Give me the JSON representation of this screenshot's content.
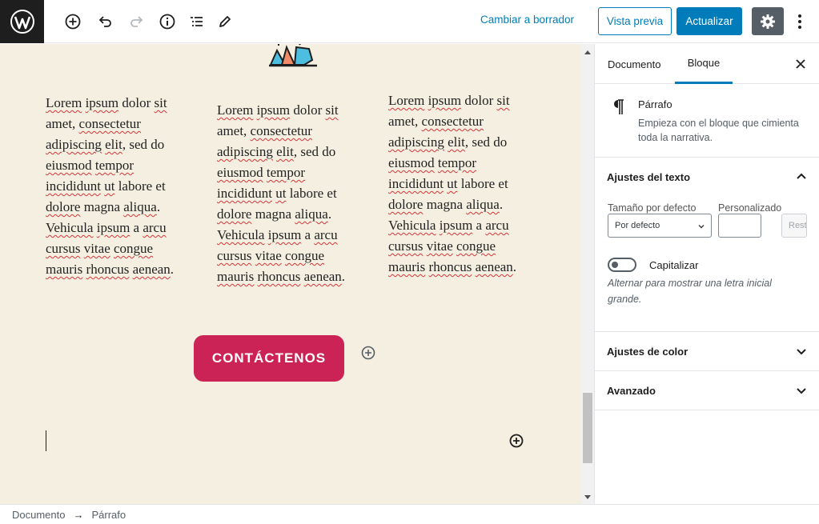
{
  "toolbar": {
    "switch_to_draft": "Cambiar a borrador",
    "preview": "Vista previa",
    "update": "Actualizar"
  },
  "content": {
    "columns": [
      [
        {
          "t": "Lorem",
          "s": true
        },
        {
          "t": " "
        },
        {
          "t": "ipsum",
          "s": true
        },
        {
          "t": " dolor "
        },
        {
          "t": "sit",
          "s": true
        },
        {
          "t": " amet, "
        },
        {
          "t": "consectetur",
          "s": true
        },
        {
          "t": " "
        },
        {
          "t": "adipiscing",
          "s": true
        },
        {
          "t": " "
        },
        {
          "t": "elit",
          "s": true
        },
        {
          "t": ", sed do "
        },
        {
          "t": "eiusmod",
          "s": true
        },
        {
          "t": " "
        },
        {
          "t": "tempor",
          "s": true
        },
        {
          "t": " "
        },
        {
          "t": "incididunt",
          "s": true
        },
        {
          "t": " "
        },
        {
          "t": "ut",
          "s": true
        },
        {
          "t": " labore et "
        },
        {
          "t": "dolore",
          "s": true
        },
        {
          "t": " magna "
        },
        {
          "t": "aliqua",
          "s": true
        },
        {
          "t": ". "
        },
        {
          "t": "Vehicula",
          "s": true
        },
        {
          "t": " "
        },
        {
          "t": "ipsum",
          "s": true
        },
        {
          "t": " a "
        },
        {
          "t": "arcu",
          "s": true
        },
        {
          "t": " "
        },
        {
          "t": "cursus",
          "s": true
        },
        {
          "t": " "
        },
        {
          "t": "vitae",
          "s": true
        },
        {
          "t": " "
        },
        {
          "t": "congue",
          "s": true
        },
        {
          "t": " "
        },
        {
          "t": "mauris",
          "s": true
        },
        {
          "t": " "
        },
        {
          "t": "rhoncus",
          "s": true
        },
        {
          "t": " "
        },
        {
          "t": "aenean",
          "s": true
        },
        {
          "t": "."
        }
      ],
      [
        {
          "t": "Lorem",
          "s": true
        },
        {
          "t": " "
        },
        {
          "t": "ipsum",
          "s": true
        },
        {
          "t": " dolor "
        },
        {
          "t": "sit",
          "s": true
        },
        {
          "t": " amet, "
        },
        {
          "t": "consectetur",
          "s": true
        },
        {
          "t": " "
        },
        {
          "t": "adipiscing",
          "s": true
        },
        {
          "t": " "
        },
        {
          "t": "elit",
          "s": true
        },
        {
          "t": ", sed do "
        },
        {
          "t": "eiusmod",
          "s": true
        },
        {
          "t": " "
        },
        {
          "t": "tempor",
          "s": true
        },
        {
          "t": " "
        },
        {
          "t": "incididunt",
          "s": true
        },
        {
          "t": " "
        },
        {
          "t": "ut",
          "s": true
        },
        {
          "t": " labore et "
        },
        {
          "t": "dolore",
          "s": true
        },
        {
          "t": " magna "
        },
        {
          "t": "aliqua",
          "s": true
        },
        {
          "t": ". "
        },
        {
          "t": "Vehicula",
          "s": true
        },
        {
          "t": " "
        },
        {
          "t": "ipsum",
          "s": true
        },
        {
          "t": " a "
        },
        {
          "t": "arcu",
          "s": true
        },
        {
          "t": " "
        },
        {
          "t": "cursus",
          "s": true
        },
        {
          "t": " "
        },
        {
          "t": "vitae",
          "s": true
        },
        {
          "t": " "
        },
        {
          "t": "congue",
          "s": true
        },
        {
          "t": " "
        },
        {
          "t": "mauris",
          "s": true
        },
        {
          "t": " "
        },
        {
          "t": "rhoncus",
          "s": true
        },
        {
          "t": " "
        },
        {
          "t": "aenean",
          "s": true
        },
        {
          "t": "."
        }
      ],
      [
        {
          "t": "Lorem",
          "s": true
        },
        {
          "t": " "
        },
        {
          "t": "ipsum",
          "s": true
        },
        {
          "t": " dolor "
        },
        {
          "t": "sit",
          "s": true
        },
        {
          "t": " amet, "
        },
        {
          "t": "consectetur",
          "s": true
        },
        {
          "t": " "
        },
        {
          "t": "adipiscing",
          "s": true
        },
        {
          "t": " "
        },
        {
          "t": "elit",
          "s": true
        },
        {
          "t": ", sed do "
        },
        {
          "t": "eiusmod",
          "s": true
        },
        {
          "t": " "
        },
        {
          "t": "tempor",
          "s": true
        },
        {
          "t": " "
        },
        {
          "t": "incididunt",
          "s": true
        },
        {
          "t": " "
        },
        {
          "t": "ut",
          "s": true
        },
        {
          "t": " labore et "
        },
        {
          "t": "dolore",
          "s": true
        },
        {
          "t": " magna "
        },
        {
          "t": "aliqua",
          "s": true
        },
        {
          "t": ". "
        },
        {
          "t": "Vehicula",
          "s": true
        },
        {
          "t": " "
        },
        {
          "t": "ipsum",
          "s": true
        },
        {
          "t": " a "
        },
        {
          "t": "arcu",
          "s": true
        },
        {
          "t": " "
        },
        {
          "t": "cursus",
          "s": true
        },
        {
          "t": " "
        },
        {
          "t": "vitae",
          "s": true
        },
        {
          "t": " "
        },
        {
          "t": "congue",
          "s": true
        },
        {
          "t": " "
        },
        {
          "t": "mauris",
          "s": true
        },
        {
          "t": " "
        },
        {
          "t": "rhoncus",
          "s": true
        },
        {
          "t": " "
        },
        {
          "t": "aenean",
          "s": true
        },
        {
          "t": "."
        }
      ]
    ],
    "cta_label": "CONTÁCTENOS"
  },
  "sidebar": {
    "tabs": [
      "Documento",
      "Bloque"
    ],
    "active_tab": "Bloque",
    "block": {
      "name": "Párrafo",
      "description": "Empieza con el bloque que cimienta toda la narrativa."
    },
    "text_settings": {
      "title": "Ajustes del texto",
      "default_size_label": "Tamaño por defecto",
      "custom_label": "Personalizado",
      "size_select_value": "Por defecto",
      "custom_value": "",
      "reset_label": "Restablecer",
      "dropcap_label": "Capitalizar",
      "dropcap_help": "Alternar para mostrar una letra inicial grande.",
      "dropcap_enabled": false
    },
    "color_settings": {
      "title": "Ajustes de color"
    },
    "advanced": {
      "title": "Avanzado"
    }
  },
  "breadcrumb": [
    "Documento",
    "Párrafo"
  ],
  "colors": {
    "accent": "#007cba",
    "cta": "#cb2355",
    "canvas_bg": "#f4efe1",
    "icon_green": "#6ab04c"
  }
}
